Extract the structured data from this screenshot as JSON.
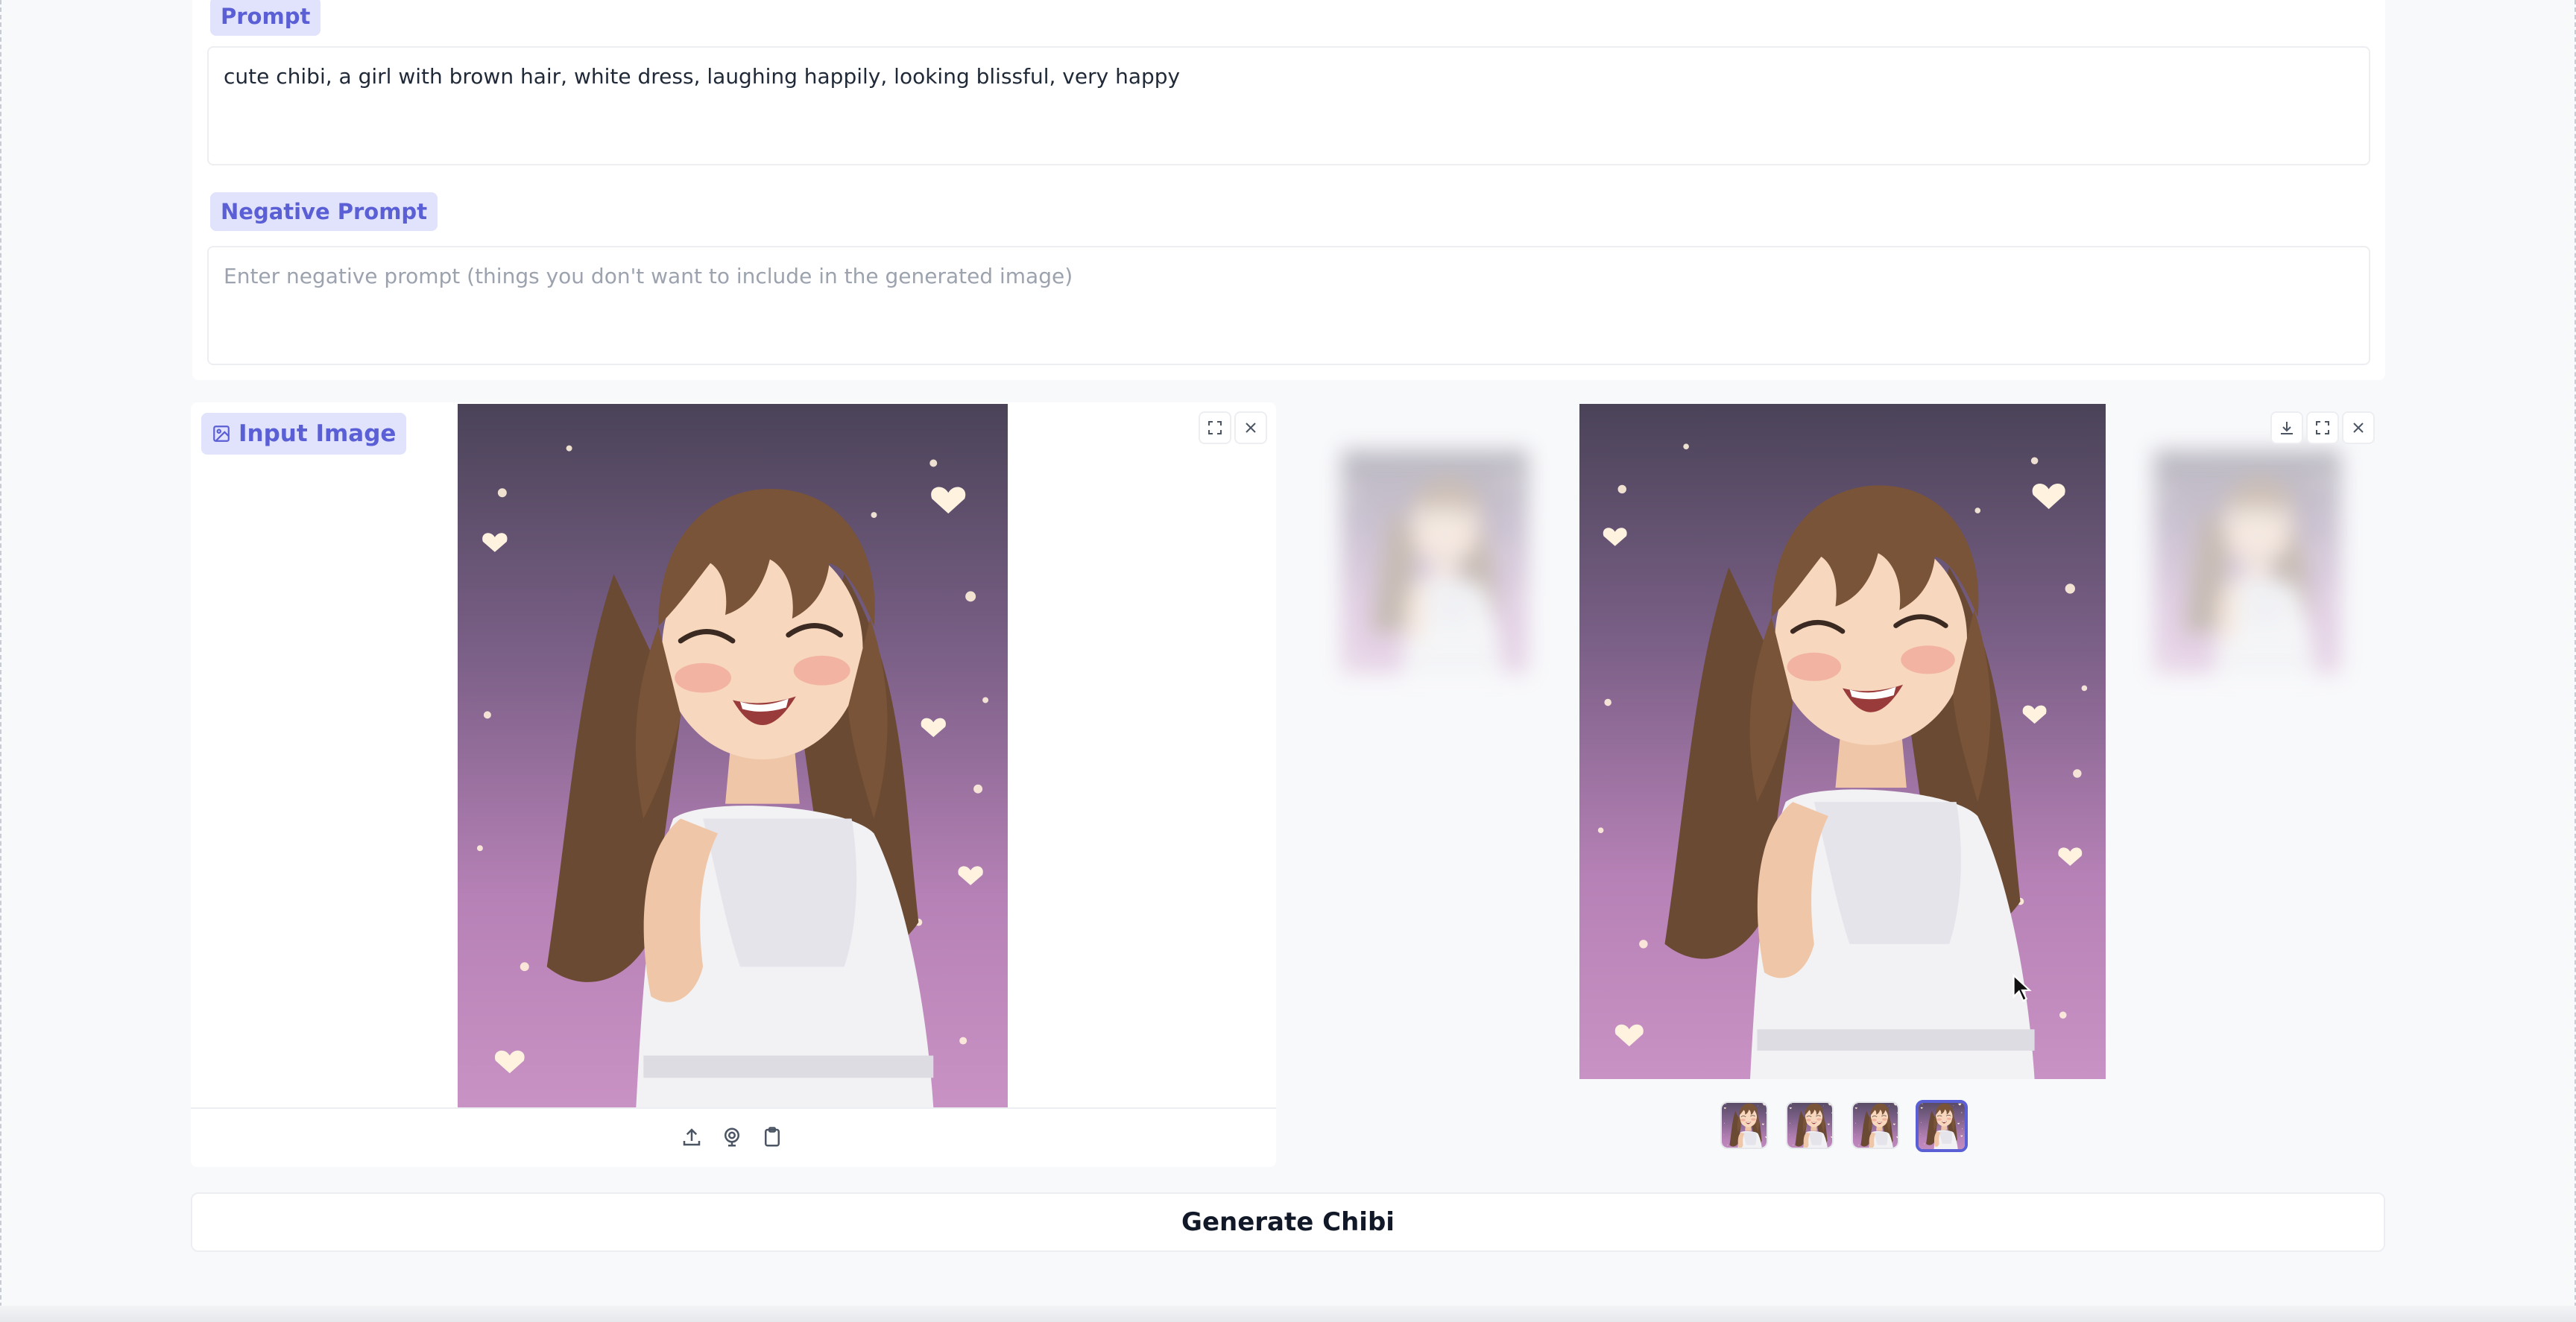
{
  "prompt_section": {
    "label": "Prompt",
    "value": "cute chibi, a girl with brown hair, white dress, laughing happily, looking blissful, very happy"
  },
  "negative_prompt_section": {
    "label": "Negative Prompt",
    "placeholder": "Enter negative prompt (things you don't want to include in the generated image)"
  },
  "input_image_panel": {
    "label": "Input Image",
    "icons": [
      "image-icon",
      "fullscreen-icon",
      "close-icon",
      "upload-icon",
      "webcam-icon",
      "clipboard-icon"
    ]
  },
  "output_gallery": {
    "icons": [
      "download-icon",
      "fullscreen-icon",
      "close-icon"
    ],
    "thumbnail_count": 4,
    "selected_thumbnail": 4
  },
  "actions": {
    "generate_label": "Generate Chibi"
  },
  "colors": {
    "accent": "#5b5fd6",
    "pill_bg": "#e0e3fb",
    "page_bg": "#f8f9fb"
  }
}
